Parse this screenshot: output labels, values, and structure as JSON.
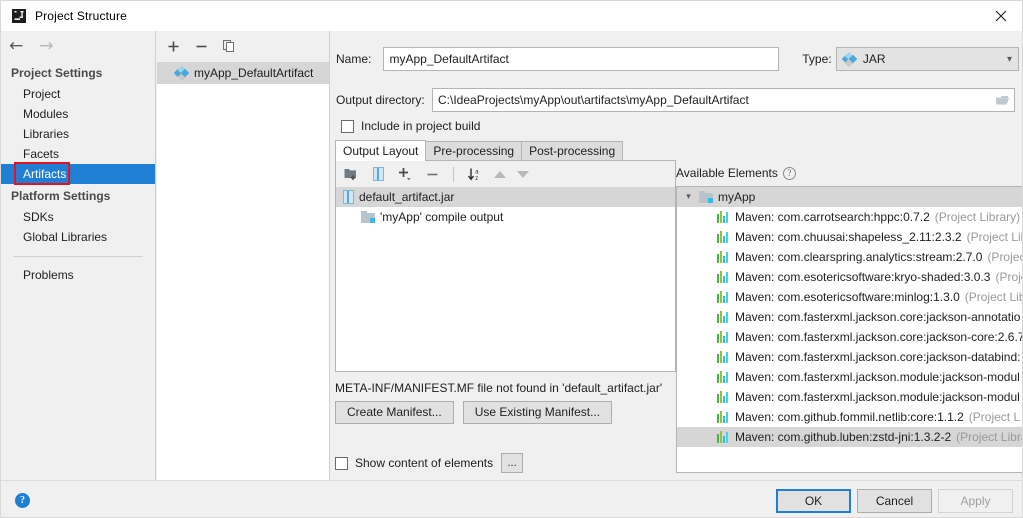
{
  "window": {
    "title": "Project Structure",
    "app_icon": "intellij-idea-icon",
    "close_label": "✕"
  },
  "sidebar": {
    "nav": {
      "back": "←",
      "forward": "→"
    },
    "groups": [
      {
        "title": "Project Settings",
        "items": [
          {
            "label": "Project",
            "selected": false
          },
          {
            "label": "Modules",
            "selected": false
          },
          {
            "label": "Libraries",
            "selected": false
          },
          {
            "label": "Facets",
            "selected": false
          },
          {
            "label": "Artifacts",
            "selected": true,
            "highlighted": true
          }
        ]
      },
      {
        "title": "Platform Settings",
        "items": [
          {
            "label": "SDKs",
            "selected": false
          },
          {
            "label": "Global Libraries",
            "selected": false
          }
        ]
      }
    ],
    "problems": {
      "label": "Problems"
    }
  },
  "artifact_list": {
    "toolbar": [
      {
        "name": "add-artifact-button",
        "glyph": "+"
      },
      {
        "name": "remove-artifact-button",
        "glyph": "−"
      },
      {
        "name": "copy-artifact-button",
        "glyph": "copy-icon"
      }
    ],
    "items": [
      {
        "label": "myApp_DefaultArtifact",
        "icon": "artifact-diamond-icon",
        "selected": true
      }
    ]
  },
  "detail": {
    "name_label": "Name:",
    "name_value": "myApp_DefaultArtifact",
    "type_label": "Type:",
    "type_value": "JAR",
    "type_icon": "artifact-diamond-icon",
    "output_dir_label": "Output directory:",
    "output_dir_value": "C:\\IdeaProjects\\myApp\\out\\artifacts\\myApp_DefaultArtifact",
    "browse_icon": "folder-browse-icon",
    "include_in_build_label": "Include in project build",
    "include_in_build_checked": false,
    "tabs": [
      {
        "label": "Output Layout",
        "active": true
      },
      {
        "label": "Pre-processing",
        "active": false
      },
      {
        "label": "Post-processing",
        "active": false
      }
    ]
  },
  "output_layout": {
    "toolbar": [
      {
        "name": "add-directory-button",
        "glyph": "folder-plus-icon"
      },
      {
        "name": "add-archive-button",
        "glyph": "jar-icon"
      },
      {
        "name": "add-element-button",
        "glyph": "plus-dropdown-icon"
      },
      {
        "name": "remove-element-button",
        "glyph": "minus-icon"
      },
      {
        "name": "sort-button",
        "glyph": "sort-az-icon"
      },
      {
        "name": "move-up-button",
        "glyph": "arrow-up-icon"
      },
      {
        "name": "move-down-button",
        "glyph": "arrow-down-icon"
      }
    ],
    "tree": [
      {
        "label": "default_artifact.jar",
        "icon": "jar-icon",
        "indent": 0,
        "selected": true
      },
      {
        "label": "'myApp' compile output",
        "icon": "compile-output-folder-icon",
        "indent": 1,
        "selected": false
      }
    ],
    "manifest_message": "META-INF/MANIFEST.MF file not found in 'default_artifact.jar'",
    "create_manifest_button": "Create Manifest...",
    "use_existing_manifest_button": "Use Existing Manifest...",
    "show_content_label": "Show content of elements",
    "show_content_checked": false,
    "show_content_more_button": "..."
  },
  "available_elements": {
    "header": "Available Elements",
    "help_icon": "help-icon",
    "root": {
      "label": "myApp",
      "icon": "module-folder-icon",
      "expanded": true
    },
    "items": [
      {
        "label": "Maven: com.carrotsearch:hppc:0.7.2",
        "scope": "(Project Library)"
      },
      {
        "label": "Maven: com.chuusai:shapeless_2.11:2.3.2",
        "scope": "(Project Libra"
      },
      {
        "label": "Maven: com.clearspring.analytics:stream:2.7.0",
        "scope": "(Project"
      },
      {
        "label": "Maven: com.esotericsoftware:kryo-shaded:3.0.3",
        "scope": "(Proje"
      },
      {
        "label": "Maven: com.esotericsoftware:minlog:1.3.0",
        "scope": "(Project Lib"
      },
      {
        "label": "Maven: com.fasterxml.jackson.core:jackson-annotatio",
        "scope": ""
      },
      {
        "label": "Maven: com.fasterxml.jackson.core:jackson-core:2.6.7",
        "scope": ""
      },
      {
        "label": "Maven: com.fasterxml.jackson.core:jackson-databind:",
        "scope": ""
      },
      {
        "label": "Maven: com.fasterxml.jackson.module:jackson-modul",
        "scope": ""
      },
      {
        "label": "Maven: com.fasterxml.jackson.module:jackson-modul",
        "scope": ""
      },
      {
        "label": "Maven: com.github.fommil.netlib:core:1.1.2",
        "scope": "(Project L"
      },
      {
        "label": "Maven: com.github.luben:zstd-jni:1.3.2-2",
        "scope": "(Project Libra"
      }
    ]
  },
  "footer": {
    "help_button": "?",
    "ok_button": "OK",
    "cancel_button": "Cancel",
    "apply_button": "Apply",
    "apply_disabled": true
  },
  "colors": {
    "accent": "#1f7fd4",
    "highlight_box": "#e81123",
    "selection_row": "#d6d6d6",
    "dialog_bg": "#f0f0f0"
  }
}
